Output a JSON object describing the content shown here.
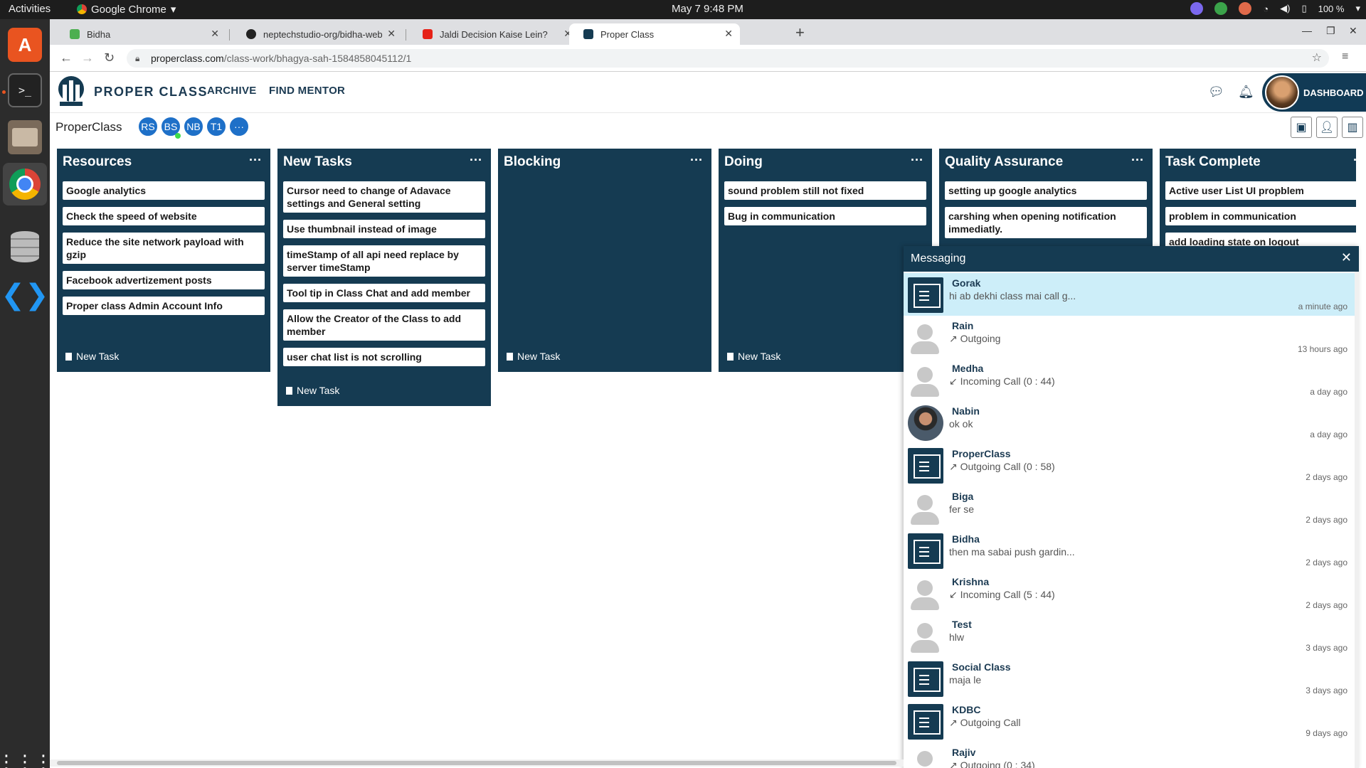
{
  "system": {
    "activities": "Activities",
    "app_name": "Google Chrome",
    "clock": "May 7  9:48 PM",
    "battery": "100 %"
  },
  "browser": {
    "tabs": [
      {
        "title": "Bidha"
      },
      {
        "title": "neptechstudio-org/bidha-web"
      },
      {
        "title": "Jaldi Decision Kaise Lein?"
      },
      {
        "title": "Proper Class"
      }
    ],
    "url_domain": "properclass.com",
    "url_path": "/class-work/bhagya-sah-1584858045112/1"
  },
  "header": {
    "brand": "PROPER CLASS",
    "nav": [
      "ARCHIVE",
      "FIND MENTOR"
    ],
    "dashboard": "DASHBOARD"
  },
  "classbar": {
    "name": "ProperClass",
    "members": [
      "RS",
      "BS",
      "NB",
      "T1",
      "···"
    ]
  },
  "board": {
    "columns": [
      {
        "title": "Resources",
        "cards": [
          "Google analytics",
          "Check the speed of website",
          "Reduce the site network payload with gzip",
          "Facebook advertizement posts",
          "Proper class Admin Account Info"
        ],
        "new_task": "New Task"
      },
      {
        "title": "New Tasks",
        "cards": [
          "Cursor need to change of Adavace settings and General setting",
          "Use thumbnail instead of image",
          "timeStamp of all api need replace by server timeStamp",
          "Tool tip in Class Chat and add member",
          "Allow the Creator of the Class to add member",
          "user chat list is not scrolling"
        ],
        "new_task": "New Task"
      },
      {
        "title": "Blocking",
        "cards": [],
        "new_task": "New Task"
      },
      {
        "title": "Doing",
        "cards": [
          "sound problem still not fixed",
          "Bug in communication"
        ],
        "new_task": "New Task"
      },
      {
        "title": "Quality Assurance",
        "cards": [
          "setting up google analytics",
          "carshing when opening notification immediatly."
        ],
        "new_task": ""
      },
      {
        "title": "Task Complete",
        "cards": [
          "Active user List UI propblem",
          "problem in communication",
          "add loading state on logout"
        ],
        "new_task": ""
      }
    ]
  },
  "messaging": {
    "title": "Messaging",
    "conversations": [
      {
        "name": "Gorak",
        "preview": "hi ab dekhi class mai call g...",
        "time": "a minute ago",
        "avatar": "group"
      },
      {
        "name": "Rain",
        "preview": "↗ Outgoing",
        "time": "13 hours ago",
        "avatar": "person"
      },
      {
        "name": "Medha",
        "preview": "↙ Incoming Call (0 : 44)",
        "time": "a day ago",
        "avatar": "person"
      },
      {
        "name": "Nabin",
        "preview": "ok ok",
        "time": "a day ago",
        "avatar": "photo"
      },
      {
        "name": "ProperClass",
        "preview": "↗ Outgoing Call (0 : 58)",
        "time": "2 days ago",
        "avatar": "group"
      },
      {
        "name": "Biga",
        "preview": "fer se",
        "time": "2 days ago",
        "avatar": "person"
      },
      {
        "name": "Bidha",
        "preview": "then ma sabai push gardin...",
        "time": "2 days ago",
        "avatar": "group"
      },
      {
        "name": "Krishna",
        "preview": "↙ Incoming Call (5 : 44)",
        "time": "2 days ago",
        "avatar": "person"
      },
      {
        "name": "Test",
        "preview": "hlw",
        "time": "3 days ago",
        "avatar": "person"
      },
      {
        "name": "Social Class",
        "preview": "maja le",
        "time": "3 days ago",
        "avatar": "group"
      },
      {
        "name": "KDBC",
        "preview": "↗ Outgoing Call",
        "time": "9 days ago",
        "avatar": "group"
      },
      {
        "name": "Rajiv",
        "preview": "↗ Outgoing (0 : 34)",
        "time": "",
        "avatar": "person"
      }
    ]
  },
  "colors": {
    "primary": "#153b52",
    "member_badge": "#1e70c8",
    "selected_convo": "#cdeef9"
  }
}
